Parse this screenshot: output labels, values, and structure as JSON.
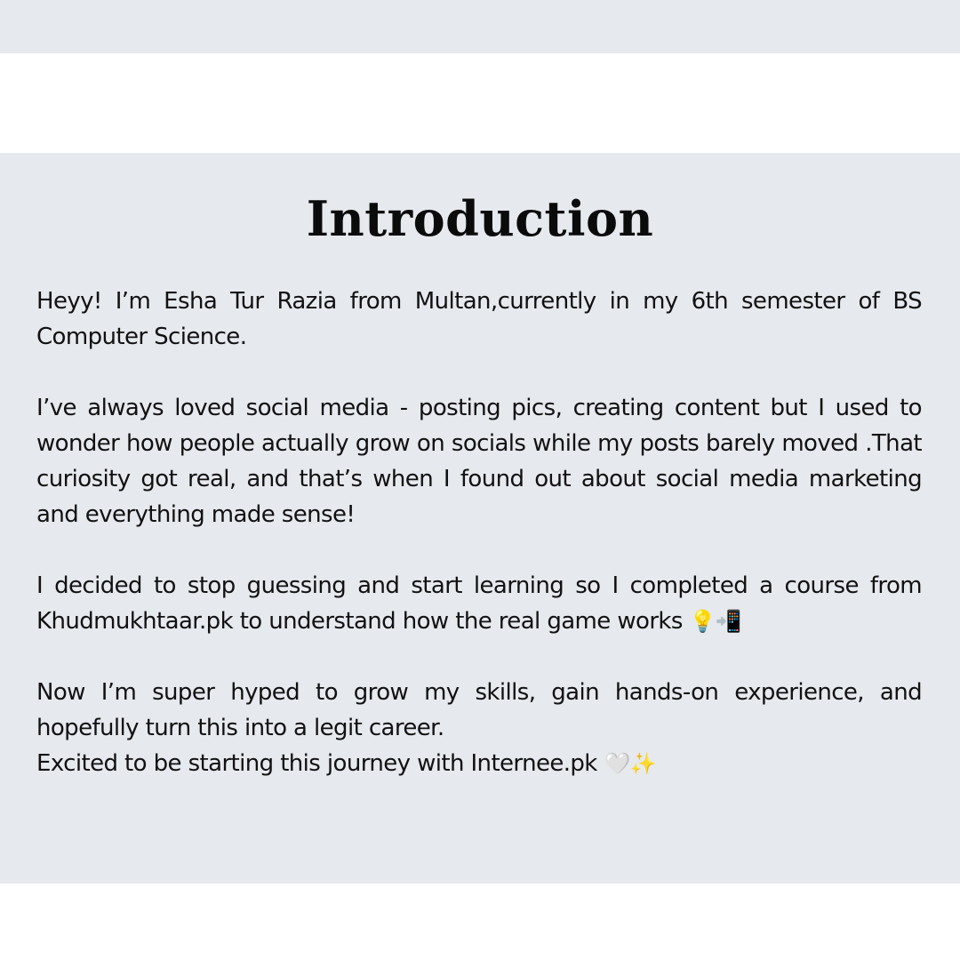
{
  "title": "Introduction",
  "paragraphs": [
    "Heyy! I’m Esha Tur Razia from Multan,currently in my  6th semester of BS Computer Science.",
    "I’ve always loved social media - posting pics, creating content but I used to wonder how people actually grow on socials while my posts barely moved .That curiosity got real, and that’s when I found out about social media marketing  and everything made sense!",
    "I decided to stop guessing and start learning so I completed a course from Khudmukhtaar.pk to understand how the real game works",
    "Now I’m super hyped to grow my skills, gain hands-on experience, and hopefully turn this into a legit career."
  ],
  "paragraph_3_emoji": "💡📲",
  "closing_line": "Excited to be starting this journey with Internee.pk",
  "closing_emoji": "🤍✨",
  "colors": {
    "panel_background": "#e6e9ee",
    "page_background": "#ffffff",
    "text": "#111111"
  }
}
